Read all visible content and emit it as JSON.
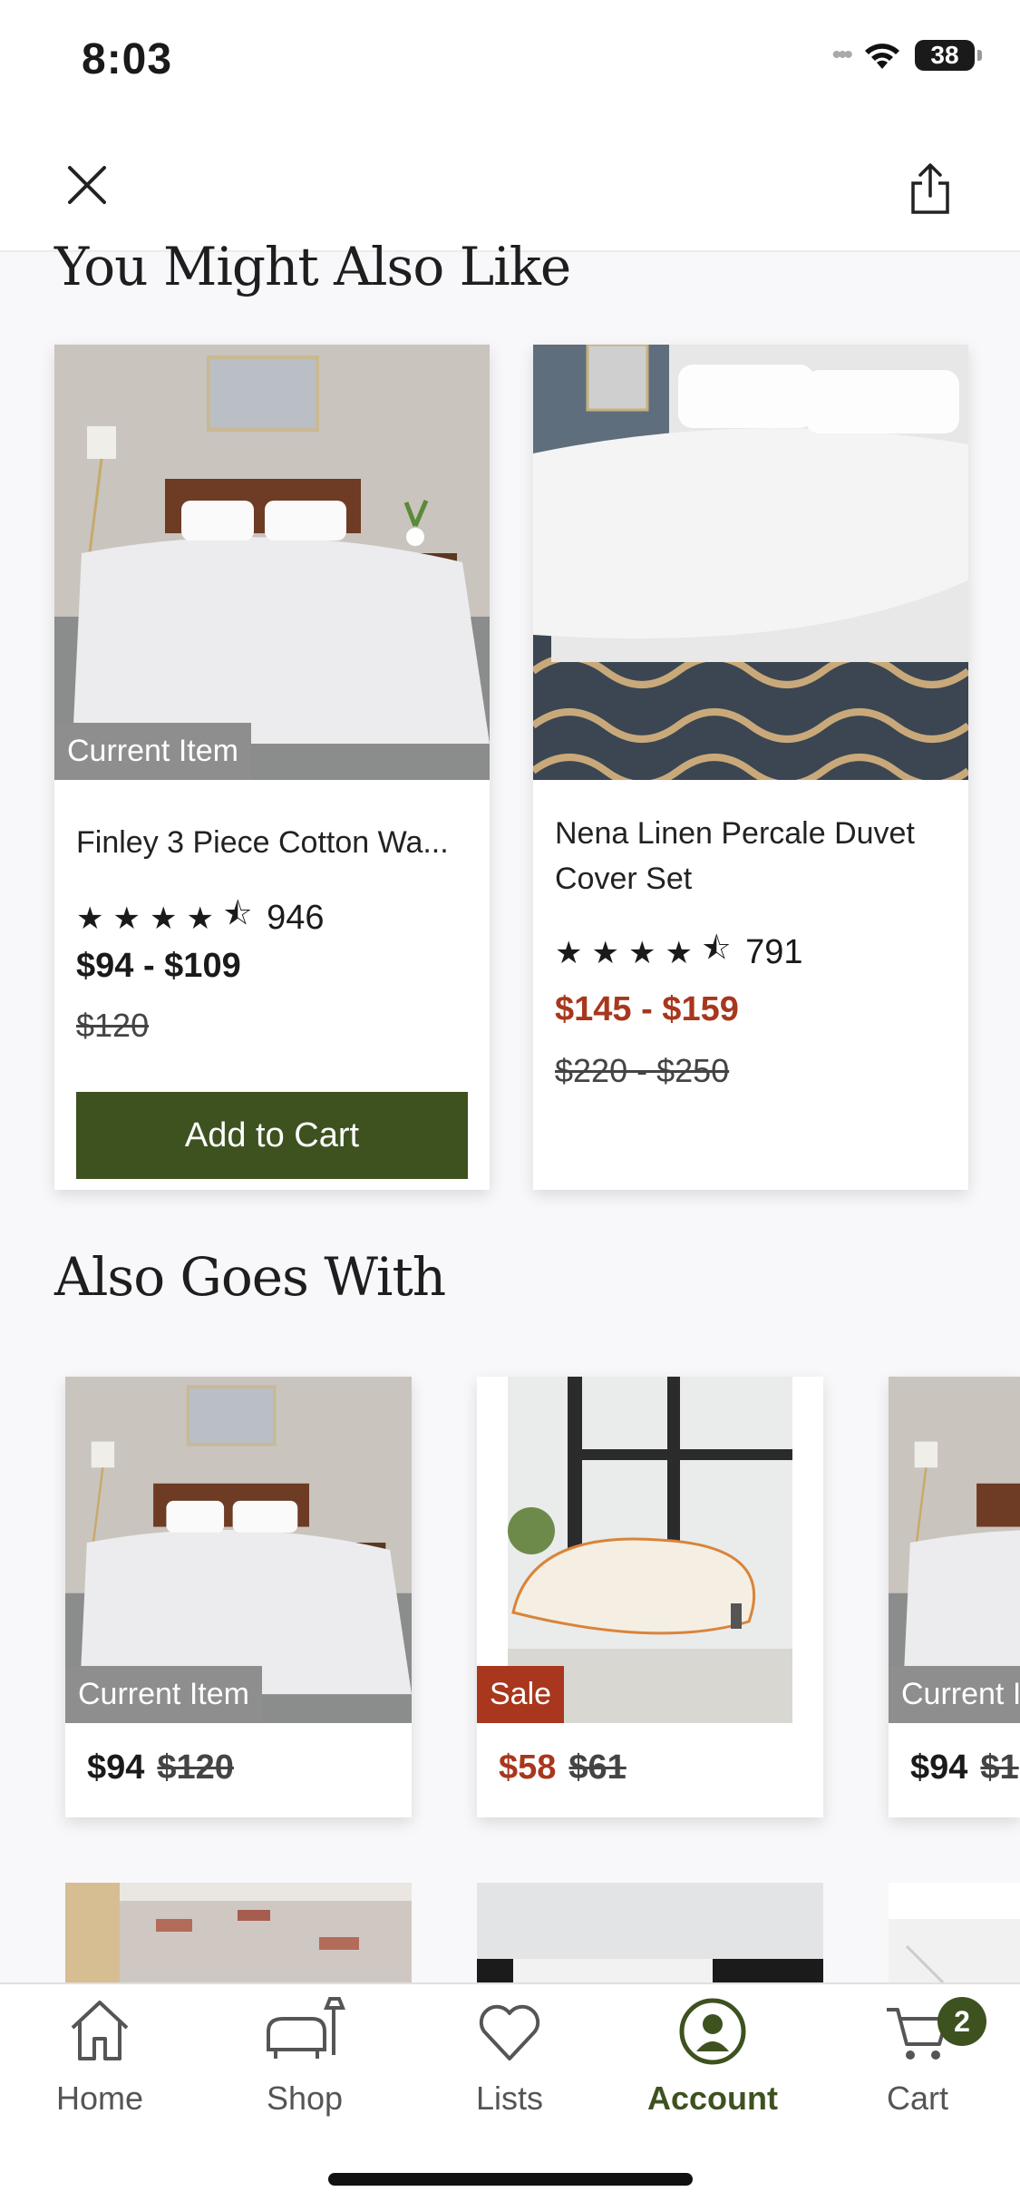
{
  "status_bar": {
    "time": "8:03",
    "battery": "38"
  },
  "sections": {
    "you_might_also_like": "You Might Also Like",
    "also_goes_with": "Also Goes With"
  },
  "recommended": [
    {
      "badge": "Current Item",
      "name": "Finley 3 Piece Cotton Wa...",
      "rating": 4.5,
      "review_count": "946",
      "price": "$94 - $109",
      "old_price": "$120",
      "button": "Add to Cart"
    },
    {
      "name": "Nena Linen Percale Duvet Cover Set",
      "rating": 4.5,
      "review_count": "791",
      "price": "$145 - $159",
      "old_price": "$220 - $250"
    }
  ],
  "goes_with": [
    {
      "badge": "Current Item",
      "price": "$94",
      "old_price": "$120"
    },
    {
      "badge": "Sale",
      "price": "$58",
      "old_price": "$61"
    },
    {
      "badge": "Current I",
      "price": "$94",
      "old_price": "$1"
    }
  ],
  "nav": {
    "home": "Home",
    "shop": "Shop",
    "lists": "Lists",
    "account": "Account",
    "cart": "Cart",
    "cart_count": "2"
  },
  "colors": {
    "brand_green": "#3e5220",
    "sale_red": "#a8371d"
  }
}
